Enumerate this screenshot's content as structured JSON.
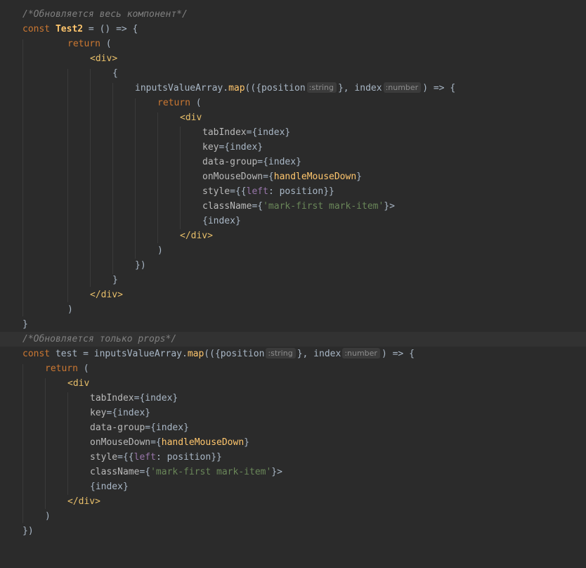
{
  "editor": {
    "theme": {
      "background": "#2b2b2b",
      "current_line": "#323232",
      "comment": "#808080",
      "keyword": "#cc7832",
      "function": "#ffc66d",
      "tag": "#e8bf6a",
      "string": "#6a8759",
      "property": "#9876aa",
      "text": "#a9b7c6",
      "inlay_hint_bg": "#3b3b3b"
    },
    "hints": {
      "string": ":string",
      "number": ":number"
    },
    "lines": [
      [
        "/*Обновляется весь компонент*/"
      ],
      [
        "const",
        " ",
        "Test2",
        " = () => {"
      ],
      [
        "return",
        " ("
      ],
      [
        "<div",
        ">"
      ],
      [
        "{"
      ],
      [
        "inputsValueArray.",
        "map",
        "(({position",
        "}, index",
        ") => {"
      ],
      [
        "return",
        " ("
      ],
      [
        "<div"
      ],
      [
        "tabIndex",
        "={index}"
      ],
      [
        "key",
        "={index}"
      ],
      [
        "data-group",
        "={index}"
      ],
      [
        "onMouseDown",
        "={",
        "handleMouseDown",
        "}"
      ],
      [
        "style",
        "={{",
        "left",
        ": position}}"
      ],
      [
        "className",
        "={",
        "'mark-first mark-item'",
        "}>"
      ],
      [
        "{index}"
      ],
      [
        "</div",
        ">"
      ],
      [
        ")"
      ],
      [
        "})"
      ],
      [
        "}"
      ],
      [
        "</div",
        ">"
      ],
      [
        ")"
      ],
      [
        "}"
      ],
      [
        "/*Обновляется только props*/"
      ],
      [
        "const",
        " test = inputsValueArray.",
        "map",
        "(({position",
        "}, index",
        ") => {"
      ],
      [
        "return",
        " ("
      ],
      [
        "<div"
      ],
      [
        "tabIndex",
        "={index}"
      ],
      [
        "key",
        "={index}"
      ],
      [
        "data-group",
        "={index}"
      ],
      [
        "onMouseDown",
        "={",
        "handleMouseDown",
        "}"
      ],
      [
        "style",
        "={{",
        "left",
        ": position}}"
      ],
      [
        "className",
        "={",
        "'mark-first mark-item'",
        "}>"
      ],
      [
        "{index}"
      ],
      [
        "</div",
        ">"
      ],
      [
        ")"
      ],
      [
        "})"
      ]
    ]
  }
}
